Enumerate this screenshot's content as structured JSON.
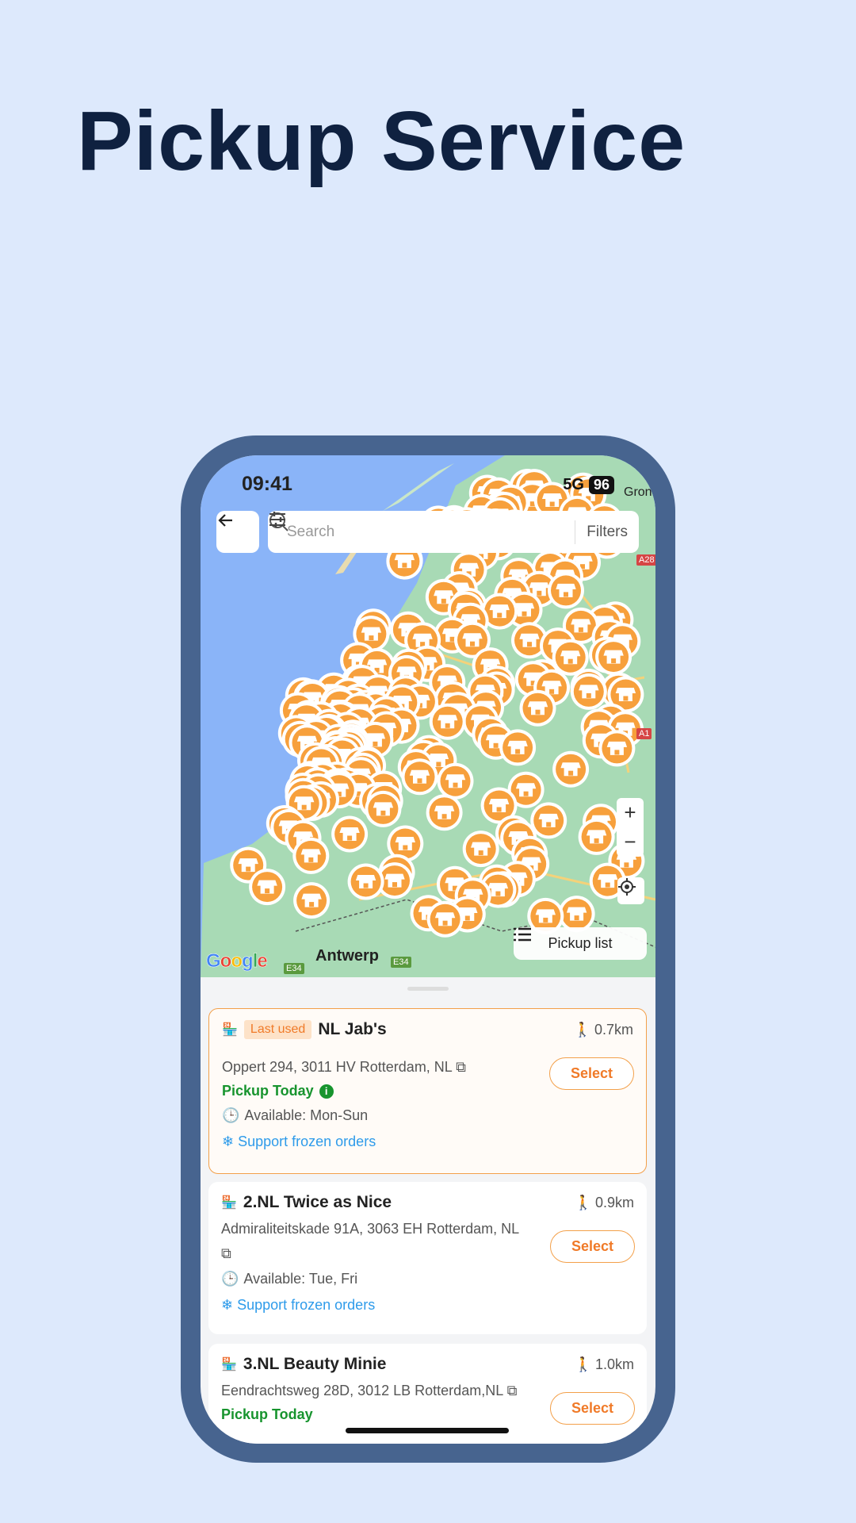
{
  "page": {
    "title": "Pickup Service"
  },
  "status": {
    "time": "09:41",
    "network": "5G",
    "battery": "96"
  },
  "search": {
    "placeholder": "Search",
    "filters_label": "Filters"
  },
  "map": {
    "labels": {
      "city_top": "Groni",
      "city_bottom": "Antwerp",
      "road1": "E34",
      "road2": "E34",
      "road3": "A28",
      "road4": "A1"
    },
    "attribution": "Google",
    "pickup_list_label": "Pickup list",
    "zoom_in": "+",
    "zoom_out": "−",
    "pin_color": "#f7a03c",
    "sea_color": "#8ab4f8",
    "land_color": "#a8dab5"
  },
  "colors": {
    "accent": "#f07a28",
    "green": "#17942e",
    "blue": "#2e9bea"
  },
  "locations": [
    {
      "name": "NL Jab's",
      "badge": "Last used",
      "distance": "0.7km",
      "address": "Oppert 294, 3011 HV Rotterdam,  NL",
      "pickup_today": "Pickup Today",
      "available": "Available: Mon-Sun",
      "frozen": "Support frozen orders",
      "select": "Select"
    },
    {
      "name": "2.NL Twice as Nice",
      "distance": "0.9km",
      "address": "Admiraliteitskade 91A, 3063 EH Rotterdam, NL",
      "available": "Available: Tue, Fri",
      "frozen": "Support frozen orders",
      "select": "Select"
    },
    {
      "name": "3.NL Beauty Minie",
      "distance": "1.0km",
      "address": "Eendrachtsweg 28D, 3012 LB Rotterdam,NL",
      "pickup_today": "Pickup Today",
      "select": "Select"
    }
  ]
}
